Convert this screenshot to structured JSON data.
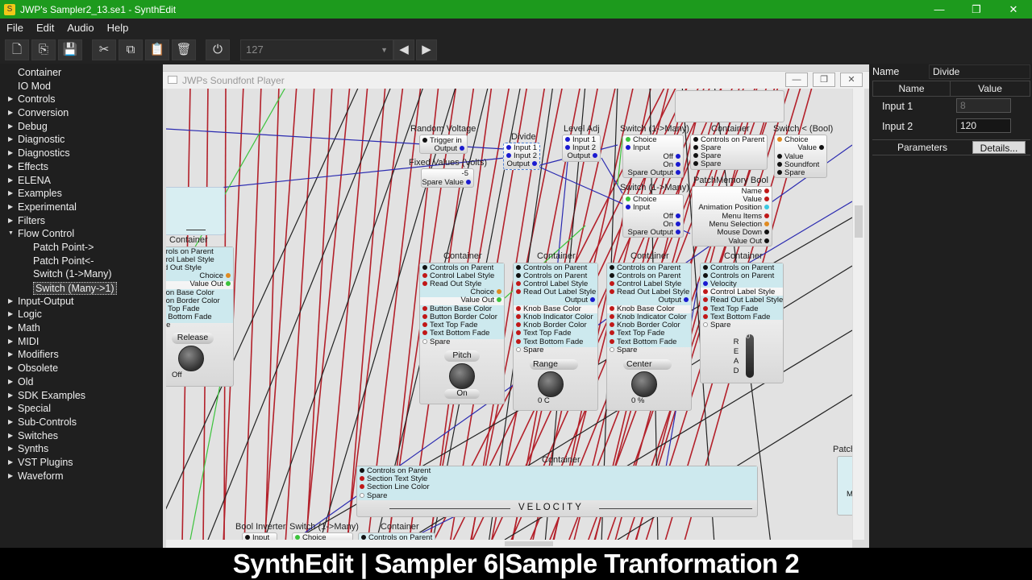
{
  "window": {
    "title": "JWP's Sampler2_13.se1 - SynthEdit",
    "minimize": "—",
    "maximize": "❐",
    "close": "✕"
  },
  "menu": [
    "File",
    "Edit",
    "Audio",
    "Help"
  ],
  "toolbar": {
    "preset_value": "127"
  },
  "sidebar": {
    "items": [
      {
        "label": "Container",
        "expandable": false,
        "child": false
      },
      {
        "label": "IO Mod",
        "expandable": false,
        "child": false
      },
      {
        "label": "Controls",
        "expandable": true,
        "child": false
      },
      {
        "label": "Conversion",
        "expandable": true,
        "child": false
      },
      {
        "label": "Debug",
        "expandable": true,
        "child": false
      },
      {
        "label": "Diagnostic",
        "expandable": true,
        "child": false
      },
      {
        "label": "Diagnostics",
        "expandable": true,
        "child": false
      },
      {
        "label": "Effects",
        "expandable": true,
        "child": false
      },
      {
        "label": "ELENA",
        "expandable": true,
        "child": false
      },
      {
        "label": "Examples",
        "expandable": true,
        "child": false
      },
      {
        "label": "Experimental",
        "expandable": true,
        "child": false
      },
      {
        "label": "Filters",
        "expandable": true,
        "child": false
      },
      {
        "label": "Flow Control",
        "expandable": true,
        "expanded": true,
        "child": false
      },
      {
        "label": "Patch Point->",
        "expandable": false,
        "child": true
      },
      {
        "label": "Patch Point<-",
        "expandable": false,
        "child": true
      },
      {
        "label": "Switch (1->Many)",
        "expandable": false,
        "child": true
      },
      {
        "label": "Switch (Many->1)",
        "expandable": false,
        "child": true,
        "selected": true
      },
      {
        "label": "Input-Output",
        "expandable": true,
        "child": false
      },
      {
        "label": "Logic",
        "expandable": true,
        "child": false
      },
      {
        "label": "Math",
        "expandable": true,
        "child": false
      },
      {
        "label": "MIDI",
        "expandable": true,
        "child": false
      },
      {
        "label": "Modifiers",
        "expandable": true,
        "child": false
      },
      {
        "label": "Obsolete",
        "expandable": true,
        "child": false
      },
      {
        "label": "Old",
        "expandable": true,
        "child": false
      },
      {
        "label": "SDK Examples",
        "expandable": true,
        "child": false
      },
      {
        "label": "Special",
        "expandable": true,
        "child": false
      },
      {
        "label": "Sub-Controls",
        "expandable": true,
        "child": false
      },
      {
        "label": "Switches",
        "expandable": true,
        "child": false
      },
      {
        "label": "Synths",
        "expandable": true,
        "child": false
      },
      {
        "label": "VST Plugins",
        "expandable": true,
        "child": false
      },
      {
        "label": "Waveform",
        "expandable": true,
        "child": false
      }
    ]
  },
  "subwindow": {
    "title": "JWPs Soundfont Player"
  },
  "canvas": {
    "modules": {
      "random_voltage": {
        "title": "Random Voltage",
        "pins": [
          "Trigger in",
          "Output"
        ]
      },
      "divide": {
        "title": "Divide",
        "pins": [
          "Input 1",
          "Input 2",
          "Output"
        ]
      },
      "level_adj": {
        "title": "Level Adj",
        "pins": [
          "Input 1",
          "Input 2",
          "Output"
        ]
      },
      "fixed_values": {
        "title": "Fixed Values (Volts)",
        "value": "-5",
        "pins": [
          "Spare Value"
        ]
      },
      "switch1": {
        "title": "Switch (1->Many)",
        "pins": [
          "Choice",
          "Input",
          "Off",
          "On",
          "Spare Output"
        ]
      },
      "switch2": {
        "title": "Switch (1->Many)",
        "pins": [
          "Choice",
          "Input",
          "Off",
          "On",
          "Spare Output"
        ]
      },
      "container_top": {
        "title": "Container",
        "pins": [
          "Controls on Parent",
          "Spare",
          "Spare",
          "Spare"
        ]
      },
      "switch_bool": {
        "title": "Switch < (Bool)",
        "pins": [
          "Choice",
          "Value",
          "Value",
          "Soundfont",
          "Spare"
        ]
      },
      "patch_memory": {
        "title": "PatchMemory Bool",
        "pins": [
          "Name",
          "Value",
          "Animation Position",
          "Menu Items",
          "Menu Selection",
          "Mouse Down",
          "Value Out"
        ]
      },
      "left_container": {
        "title": "Container",
        "pins": [
          "trols on Parent",
          "trol Label Style",
          "d Out Style",
          "Choice",
          "Value Out",
          "ton Base Color",
          "ton Border Color",
          ": Top Fade",
          ": Bottom Fade",
          "re"
        ],
        "button": "Release",
        "off": "Off"
      },
      "pitch_container": {
        "title": "Container",
        "pins": [
          "Controls on Parent",
          "Control Label Style",
          "Read Out Style",
          "Choice",
          "Value Out",
          "Button Base Color",
          "Button Border Color",
          "Text Top Fade",
          "Text Bottom Fade",
          "Spare"
        ],
        "button": "Pitch",
        "state": "On"
      },
      "range_container": {
        "title": "Container",
        "pins": [
          "Controls on Parent",
          "Controls on Parent",
          "Control Label Style",
          "Read Out Label Style",
          "Output",
          "Knob Base Color",
          "Knob Indicator Color",
          "Knob Border Color",
          "Text Top Fade",
          "Text Bottom Fade",
          "Spare"
        ],
        "knob": "Range",
        "readout": "0   C"
      },
      "center_container": {
        "title": "Container",
        "pins": [
          "Controls on Parent",
          "Controls on Parent",
          "Control Label Style",
          "Read Out Label Style",
          "Output",
          "Knob Base Color",
          "Knob Indicator Color",
          "Knob Border Color",
          "Text Top Fade",
          "Text Bottom Fade",
          "Spare"
        ],
        "knob": "Center",
        "readout": "0   %"
      },
      "read_container": {
        "title": "Container",
        "pins": [
          "Controls on Parent",
          "Controls on Parent",
          "Velocity",
          "Control Label Style",
          "Read Out Label Style",
          "Text Top Fade",
          "Text Bottom Fade",
          "Spare"
        ],
        "vlabel": "R\nE\nA\nD",
        "vvalue": "0"
      },
      "velocity_container": {
        "title": "Container",
        "pins": [
          "Controls on Parent",
          "Section Text Style",
          "Section Line Color",
          "Spare"
        ],
        "section": "VELOCITY"
      },
      "bottom_labels": [
        "Bool Inverter",
        "Switch (1->Many)",
        "Container"
      ],
      "bottom_pins": [
        "Input",
        "Choice",
        "Controls on Parent"
      ],
      "patch_partial": "Patch",
      "partial_m": "M"
    }
  },
  "properties": {
    "name_label": "Name",
    "name_value": "Divide",
    "col_name": "Name",
    "col_value": "Value",
    "rows": [
      {
        "name": "Input 1",
        "value": "8"
      },
      {
        "name": "Input 2",
        "value": "120"
      }
    ],
    "tab_parameters": "Parameters",
    "tab_details": "Details..."
  },
  "caption": "SynthEdit | Sampler 6|Sample Tranformation 2",
  "colors": {
    "titlebar": "#1d9a1d",
    "wire_red": "#b3202a",
    "wire_blue": "#2a2ab0",
    "wire_black": "#222222",
    "wire_green": "#3cc33c",
    "module_band": "#cde9ee"
  }
}
